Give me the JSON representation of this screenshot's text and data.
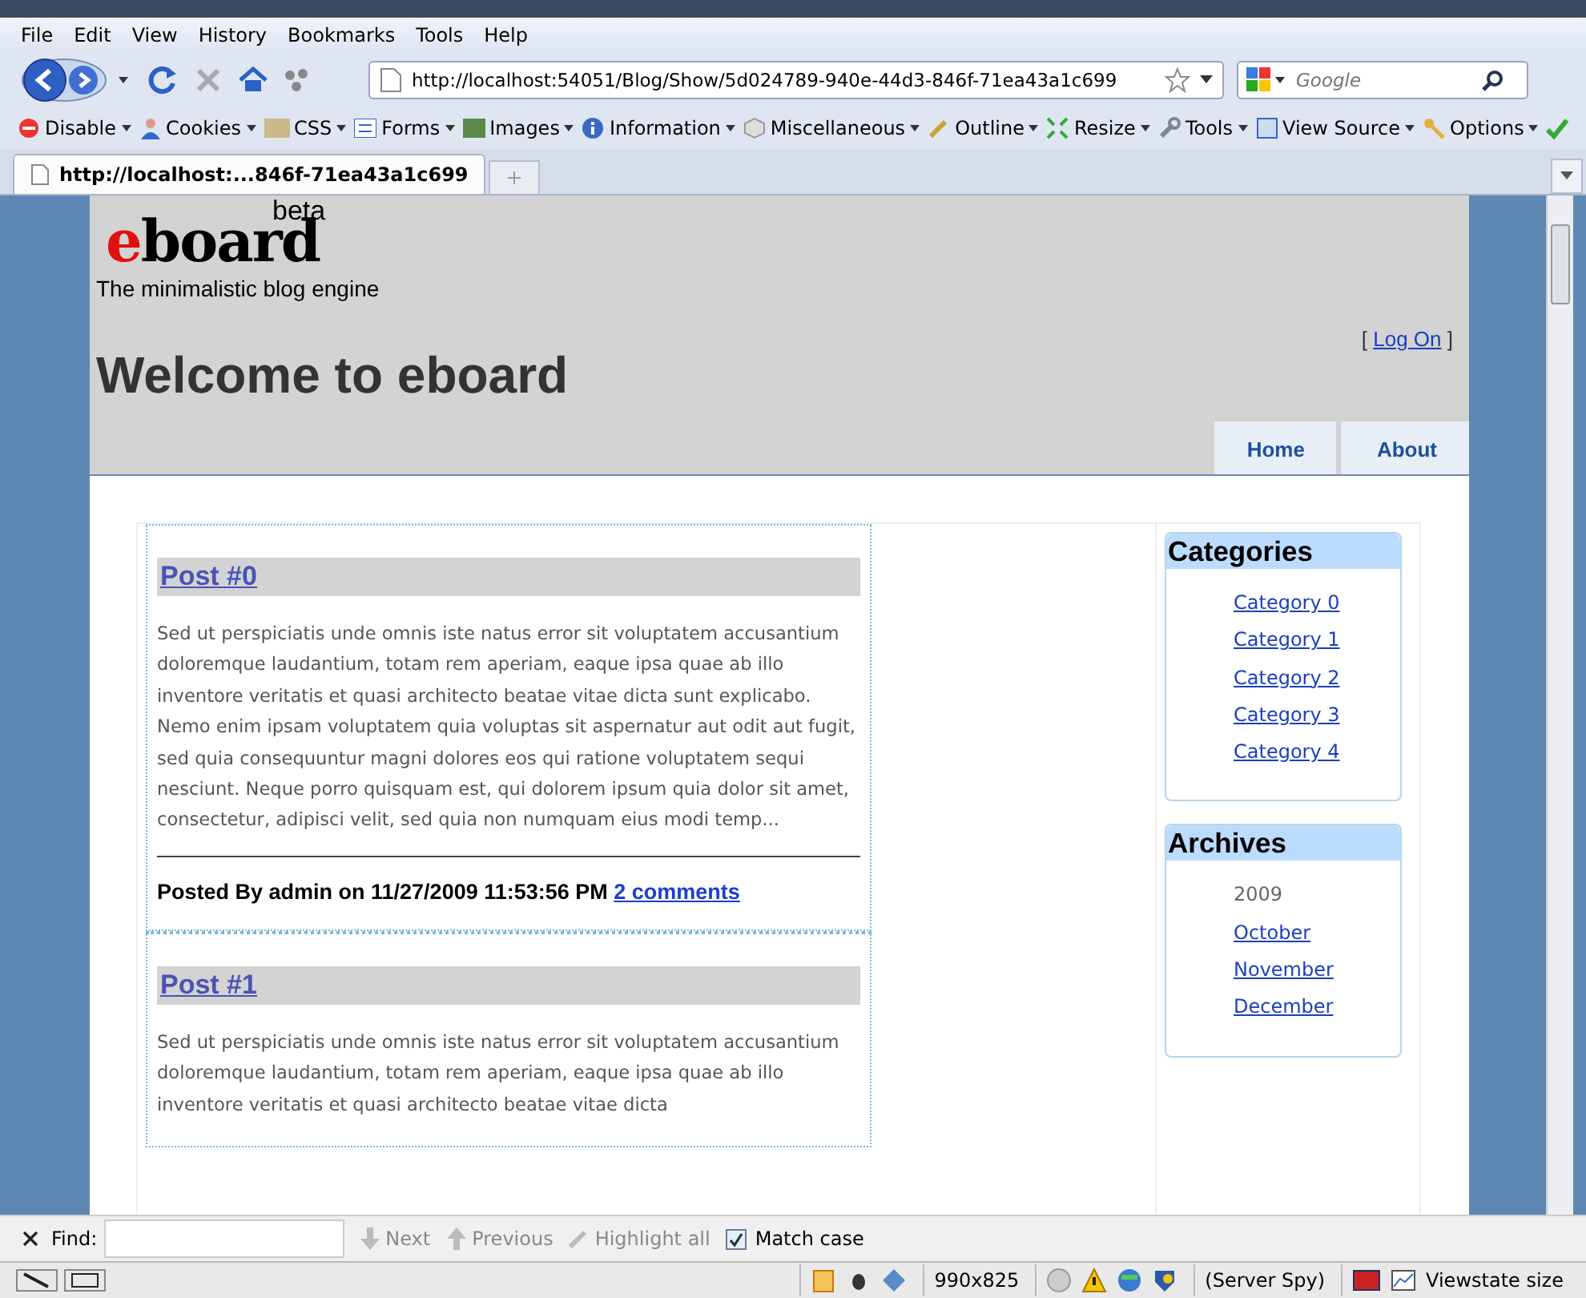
{
  "menu_bar": [
    "File",
    "Edit",
    "View",
    "History",
    "Bookmarks",
    "Tools",
    "Help"
  ],
  "nav": {
    "url": "http://localhost:54051/Blog/Show/5d024789-940e-44d3-846f-71ea43a1c699",
    "search_placeholder": "Google"
  },
  "toolbar": [
    {
      "label": "Disable"
    },
    {
      "label": "Cookies"
    },
    {
      "label": "CSS"
    },
    {
      "label": "Forms"
    },
    {
      "label": "Images"
    },
    {
      "label": "Information"
    },
    {
      "label": "Miscellaneous"
    },
    {
      "label": "Outline"
    },
    {
      "label": "Resize"
    },
    {
      "label": "Tools"
    },
    {
      "label": "View Source"
    },
    {
      "label": "Options"
    }
  ],
  "tabs": [
    {
      "label": "http://localhost:...846f-71ea43a1c699",
      "selected": true
    }
  ],
  "site": {
    "logo_tag": "beta",
    "logo_e": "e",
    "logo_rest": "board",
    "tagline": "The minimalistic blog engine",
    "login_open": "[",
    "login_link": "Log On",
    "login_close": "]",
    "heading": "Welcome to eboard",
    "nav": [
      {
        "label": "Home"
      },
      {
        "label": "About"
      }
    ]
  },
  "posts": [
    {
      "title": "Post #0",
      "excerpt": "Sed ut perspiciatis unde omnis iste natus error sit voluptatem accusantium doloremque laudantium, totam rem aperiam, eaque ipsa quae ab illo inventore veritatis et quasi architecto beatae vitae dicta sunt explicabo. Nemo enim ipsam voluptatem quia voluptas sit aspernatur aut odit aut fugit, sed quia consequuntur magni dolores eos qui ratione voluptatem sequi nesciunt. Neque porro quisquam est, qui dolorem ipsum quia dolor sit amet, consectetur, adipisci velit, sed quia non numquam eius modi temp...",
      "byline": "Posted By admin on 11/27/2009 11:53:56 PM",
      "comments": "2 comments"
    },
    {
      "title": "Post #1",
      "excerpt": "Sed ut perspiciatis unde omnis iste natus error sit voluptatem accusantium doloremque laudantium, totam rem aperiam, eaque ipsa quae ab illo inventore veritatis et quasi architecto beatae vitae dicta"
    }
  ],
  "sidebar": [
    {
      "title": "Categories",
      "items": [
        {
          "kind": "link",
          "label": "Category 0"
        },
        {
          "kind": "link",
          "label": "Category 1"
        },
        {
          "kind": "link",
          "label": "Category 2"
        },
        {
          "kind": "link",
          "label": "Category 3"
        },
        {
          "kind": "link",
          "label": "Category 4"
        }
      ]
    },
    {
      "title": "Archives",
      "items": [
        {
          "kind": "year",
          "label": "2009"
        },
        {
          "kind": "link",
          "label": "October"
        },
        {
          "kind": "link",
          "label": "November"
        },
        {
          "kind": "link",
          "label": "December"
        }
      ]
    }
  ],
  "find_bar": {
    "label": "Find:",
    "next": "Next",
    "previous": "Previous",
    "highlight": "Highlight all",
    "match_case": {
      "label": "Match case",
      "checked": true
    }
  },
  "status_bar": {
    "size": "990x825",
    "server_spy": "(Server Spy)",
    "viewstate": "Viewstate size"
  }
}
